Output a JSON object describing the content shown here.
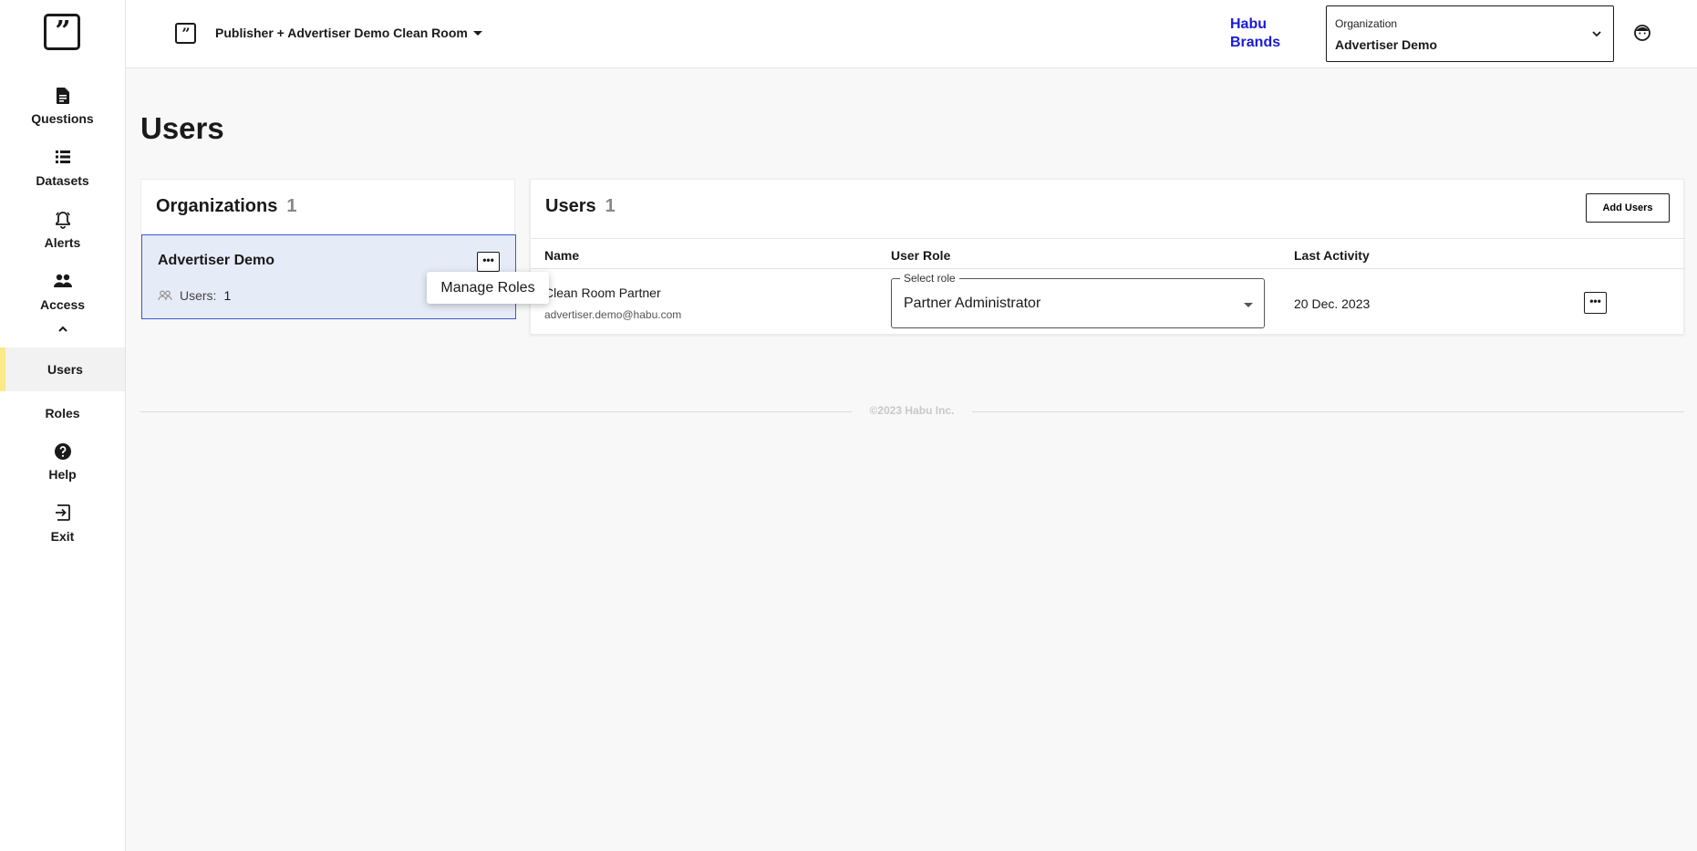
{
  "app": {
    "logo_glyph": "”"
  },
  "sidebar": {
    "items": [
      {
        "label": "Questions",
        "icon": "document-icon"
      },
      {
        "label": "Datasets",
        "icon": "list-icon"
      },
      {
        "label": "Alerts",
        "icon": "bell-icon"
      },
      {
        "label": "Access",
        "icon": "people-icon",
        "expanded": true
      }
    ],
    "sub_items": [
      {
        "label": "Users",
        "active": true
      },
      {
        "label": "Roles",
        "active": false
      }
    ],
    "bottom_items": [
      {
        "label": "Help",
        "icon": "help-icon"
      },
      {
        "label": "Exit",
        "icon": "exit-icon"
      }
    ]
  },
  "topbar": {
    "clean_room_title": "Publisher + Advertiser Demo Clean Room",
    "brand_link": "Habu Brands",
    "org_select": {
      "label": "Organization",
      "value": "Advertiser Demo"
    }
  },
  "page": {
    "title": "Users"
  },
  "organizations_panel": {
    "title": "Organizations",
    "count": "1",
    "card": {
      "name": "Advertiser Demo",
      "users_label": "Users:",
      "users_count": "1",
      "more": "•••"
    }
  },
  "popover": {
    "label": "Manage Roles"
  },
  "users_panel": {
    "title": "Users",
    "count": "1",
    "add_button": "Add Users",
    "columns": [
      "Name",
      "User Role",
      "Last Activity"
    ],
    "rows": [
      {
        "name": "Clean Room Partner",
        "email": "advertiser.demo@habu.com",
        "role_label": "Select role",
        "role": "Partner Administrator",
        "last_activity": "20 Dec. 2023",
        "more": "•••"
      }
    ]
  },
  "footer": {
    "text": "©2023 Habu Inc."
  },
  "colors": {
    "accent_active": "#fbe98a",
    "brand_link": "#1a1ad6",
    "selected_card_bg": "#e6ebf8",
    "selected_card_border": "#3b5bd0"
  }
}
